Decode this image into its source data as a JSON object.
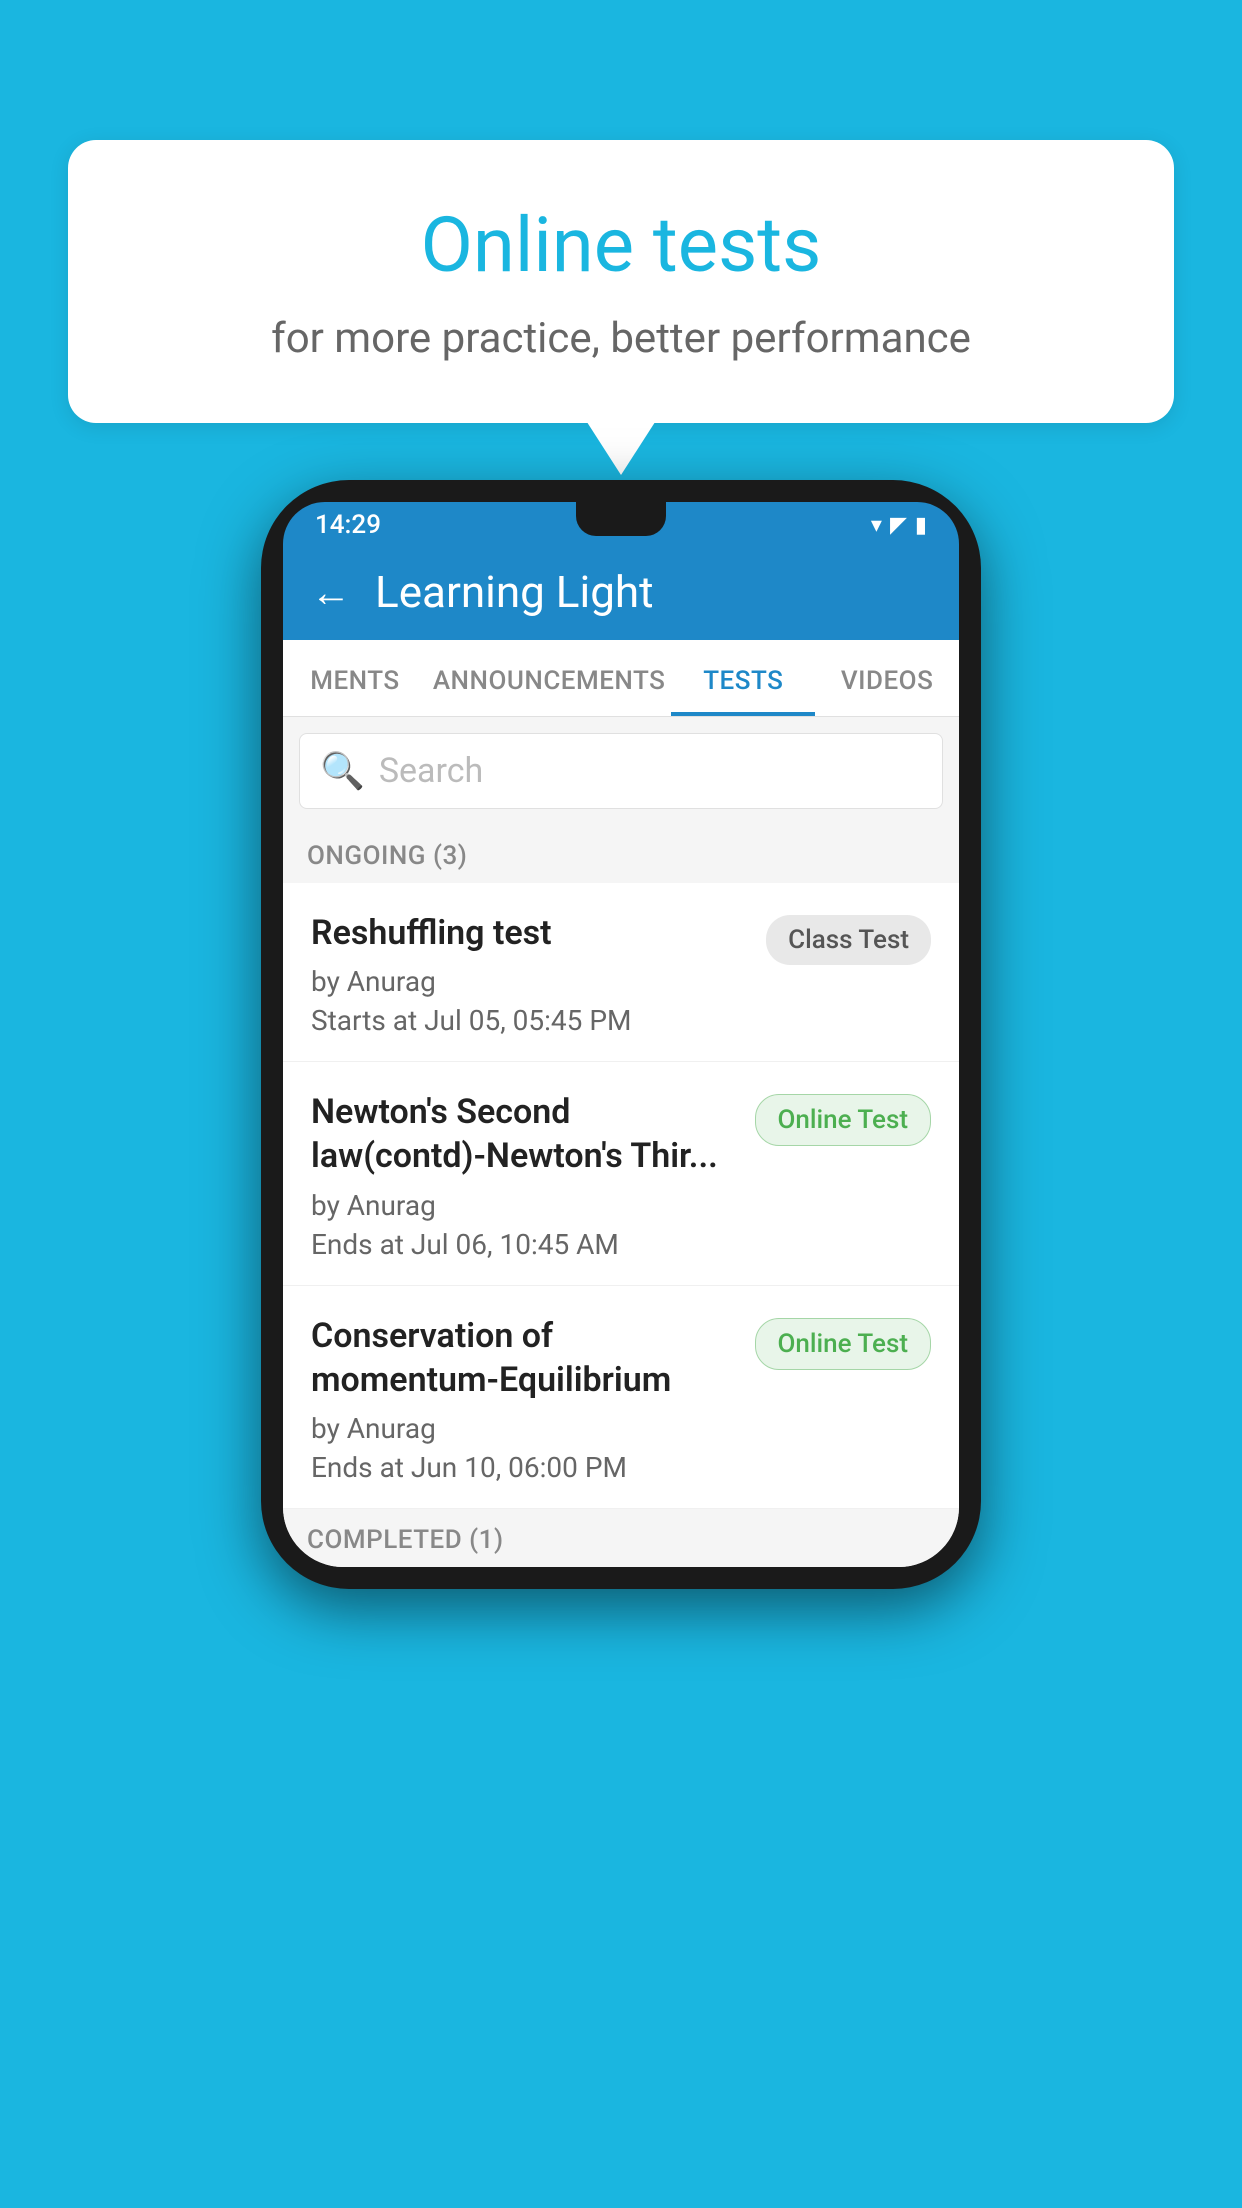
{
  "background_color": "#1ab6e0",
  "bubble": {
    "title": "Online tests",
    "subtitle": "for more practice, better performance"
  },
  "phone": {
    "time": "14:29",
    "header": {
      "back_label": "←",
      "title": "Learning Light"
    },
    "tabs": [
      {
        "label": "MENTS",
        "active": false
      },
      {
        "label": "ANNOUNCEMENTS",
        "active": false
      },
      {
        "label": "TESTS",
        "active": true
      },
      {
        "label": "VIDEOS",
        "active": false
      }
    ],
    "search": {
      "placeholder": "Search"
    },
    "ongoing_label": "ONGOING (3)",
    "tests": [
      {
        "name": "Reshuffling test",
        "by": "by Anurag",
        "time_label": "Starts at",
        "time": "Jul 05, 05:45 PM",
        "badge": "Class Test",
        "badge_type": "class"
      },
      {
        "name": "Newton's Second law(contd)-Newton's Thir...",
        "by": "by Anurag",
        "time_label": "Ends at",
        "time": "Jul 06, 10:45 AM",
        "badge": "Online Test",
        "badge_type": "online"
      },
      {
        "name": "Conservation of momentum-Equilibrium",
        "by": "by Anurag",
        "time_label": "Ends at",
        "time": "Jun 10, 06:00 PM",
        "badge": "Online Test",
        "badge_type": "online"
      }
    ],
    "completed_label": "COMPLETED (1)"
  }
}
